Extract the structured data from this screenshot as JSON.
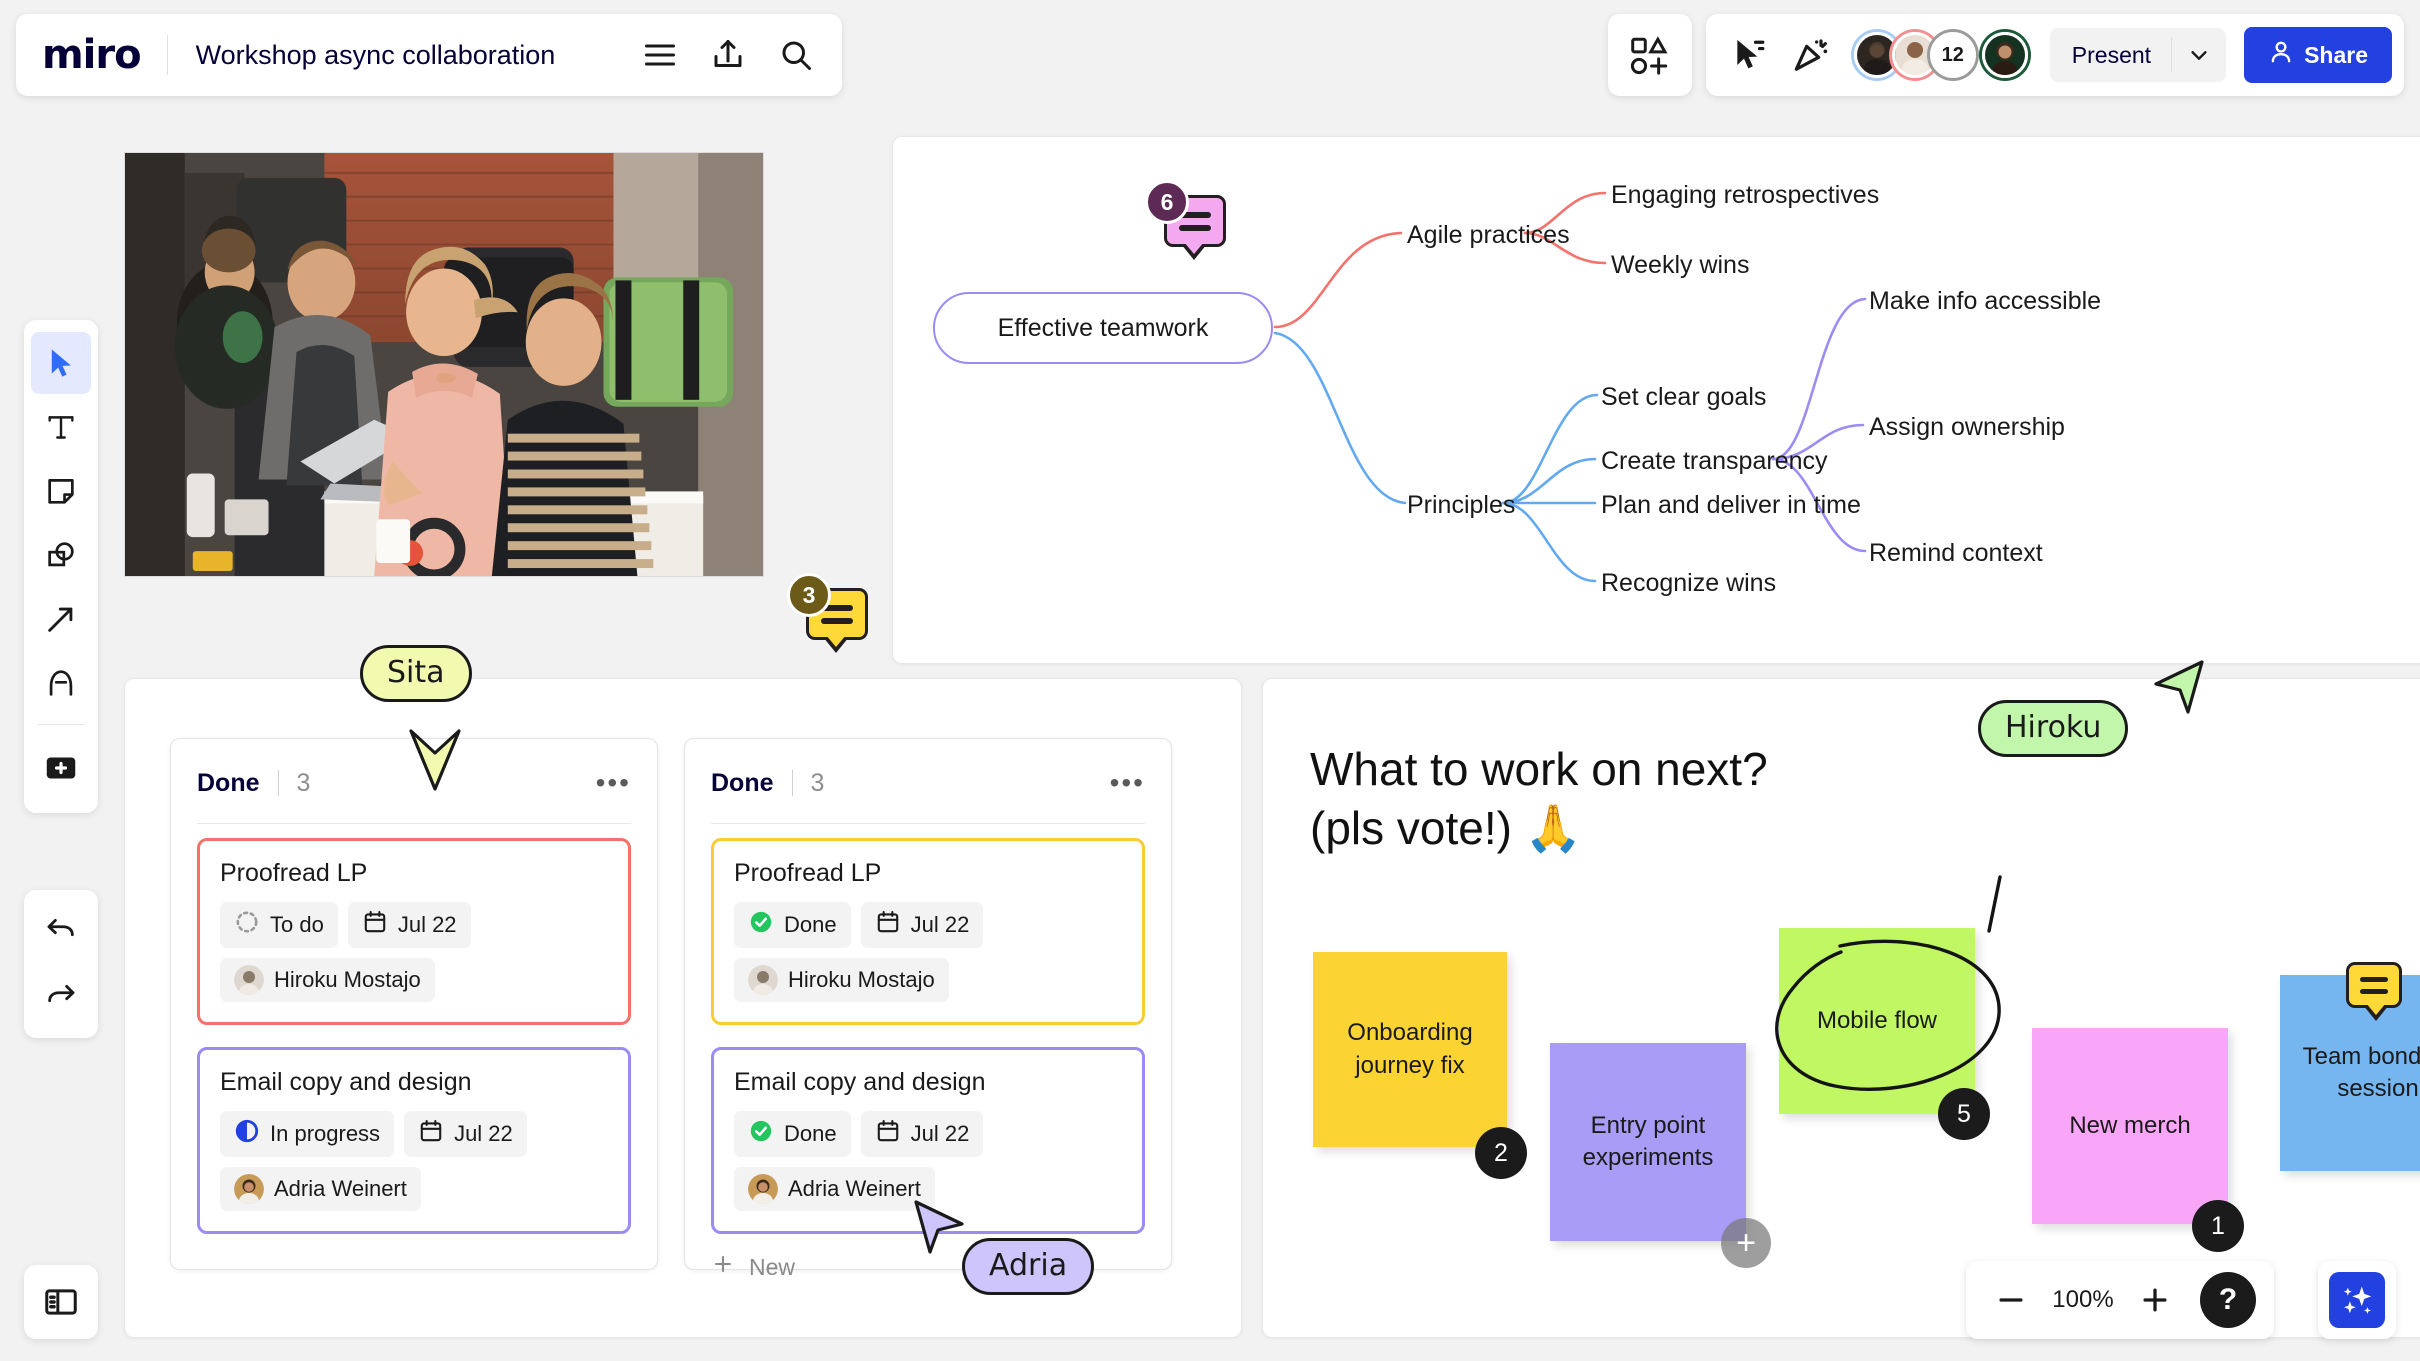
{
  "header": {
    "logo": "miro",
    "board_title": "Workshop async collaboration",
    "icons": [
      "menu-icon",
      "upload-icon",
      "search-icon"
    ]
  },
  "toolbar_right": {
    "shapes_panel_icon": "shapes-grid-icon",
    "select_tool_icon": "cursor-select-icon",
    "reactions_tool_icon": "celebration-icon",
    "collaborators": [
      {
        "name": "Collaborator 1",
        "ring": "#a8cdf4"
      },
      {
        "name": "Collaborator 2",
        "ring": "#f58f8f"
      },
      {
        "name": "Collaborator 4",
        "ring": "#1d5a3a"
      }
    ],
    "extra_count": "12",
    "present_label": "Present",
    "present_caret": "chevron-down-icon",
    "share_label": "Share",
    "share_color": "#2340e0"
  },
  "left_toolbar": {
    "tools": [
      {
        "name": "select-tool",
        "icon": "cursor-icon",
        "active": true
      },
      {
        "name": "text-tool",
        "icon": "text-T-icon",
        "active": false
      },
      {
        "name": "sticky-note-tool",
        "icon": "sticky-note-icon",
        "active": false
      },
      {
        "name": "shapes-tool",
        "icon": "shapes-icon",
        "active": false
      },
      {
        "name": "connector-tool",
        "icon": "arrow-icon",
        "active": false
      },
      {
        "name": "pen-tool",
        "icon": "pen-arc-icon",
        "active": false
      },
      {
        "name": "more-apps-tool",
        "icon": "plus-square-icon",
        "active": false
      }
    ],
    "undo": "undo-icon",
    "redo": "redo-icon",
    "panel_toggle": "side-panel-icon"
  },
  "mindmap": {
    "root": "Effective teamwork",
    "branches": [
      {
        "label": "Agile practices",
        "color": "#f4726c",
        "children": [
          {
            "label": "Engaging retrospectives"
          },
          {
            "label": "Weekly wins"
          }
        ]
      },
      {
        "label": "Principles",
        "color": "#62a9f0",
        "children": [
          {
            "label": "Set clear goals"
          },
          {
            "label": "Create transparency",
            "color": "#9b8cf5",
            "children": [
              {
                "label": "Make info accessible"
              },
              {
                "label": "Assign ownership"
              },
              {
                "label": "Remind context"
              }
            ]
          },
          {
            "label": "Plan and deliver in time"
          },
          {
            "label": "Recognize wins"
          }
        ]
      }
    ]
  },
  "comment_pins": [
    {
      "id": "pin-mindmap",
      "count": "6",
      "fill": "#f4a8f0",
      "badge": "#5d2a55"
    },
    {
      "id": "pin-photo",
      "count": "3",
      "fill": "#ffd938",
      "badge": "#6b5a18"
    },
    {
      "id": "pin-sticky-teambonding",
      "count": "",
      "fill": "#ffd938",
      "badge": ""
    }
  ],
  "kanban": {
    "columns": [
      {
        "title": "Done",
        "count": "3",
        "more_icon": "more-dots-icon",
        "cards": [
          {
            "title": "Proofread LP",
            "border": "#f4726c",
            "status": {
              "label": "To do",
              "icon": "todo-dotted-circle-icon",
              "color": "#8e8e8e"
            },
            "date": {
              "label": "Jul 22",
              "icon": "calendar-icon"
            },
            "assignee": "Hiroku Mostajo",
            "assignee_layout": "own-row"
          },
          {
            "title": "Email copy and design",
            "border": "#9b8cf5",
            "status": {
              "label": "In progress",
              "icon": "half-circle-icon",
              "color": "#2340e0"
            },
            "date": {
              "label": "Jul 22",
              "icon": "calendar-icon"
            },
            "assignee": "Adria Weinert",
            "assignee_layout": "own-row"
          }
        ],
        "new_label": ""
      },
      {
        "title": "Done",
        "count": "3",
        "more_icon": "more-dots-icon",
        "cards": [
          {
            "title": "Proofread LP",
            "border": "#f7cc35",
            "status": {
              "label": "Done",
              "icon": "check-circle-icon",
              "color": "#22c55e"
            },
            "date": {
              "label": "Jul 22",
              "icon": "calendar-icon"
            },
            "assignee": "Hiroku Mostajo",
            "assignee_layout": "own-row"
          },
          {
            "title": "Email copy and design",
            "border": "#9b8cf5",
            "status": {
              "label": "Done",
              "icon": "check-circle-icon",
              "color": "#22c55e"
            },
            "date": {
              "label": "Jul 22",
              "icon": "calendar-icon"
            },
            "assignee": "Adria Weinert",
            "assignee_layout": "inline"
          }
        ],
        "new_label": "New"
      }
    ]
  },
  "voting": {
    "title_line1": "What to work on next?",
    "title_line2": "(pls vote!) 🙏",
    "stickies": [
      {
        "text": "Onboarding journey fix",
        "color": "#fbd433",
        "votes": "2"
      },
      {
        "text": "Entry point experiments",
        "color": "#a99cf7",
        "votes": ""
      },
      {
        "text": "Mobile flow",
        "color": "#c0f762",
        "votes": "5",
        "annotated": true
      },
      {
        "text": "New merch",
        "color": "#f9a6f9",
        "votes": "1"
      },
      {
        "text": "Team bonding session",
        "color": "#75b5f0",
        "votes": ""
      }
    ],
    "add_button": "plus-icon"
  },
  "cursors": [
    {
      "name": "Sita",
      "color": "#f2fab0",
      "direction": "down"
    },
    {
      "name": "Adria",
      "color": "#cdc5fb",
      "direction": "up-left"
    },
    {
      "name": "Hiroku",
      "color": "#c2f7ab",
      "direction": "up-right"
    }
  ],
  "zoom_controls": {
    "minus": "minus-icon",
    "level": "100%",
    "plus": "plus-icon",
    "help": "?",
    "ai_icon": "ai-sparkles-icon"
  }
}
